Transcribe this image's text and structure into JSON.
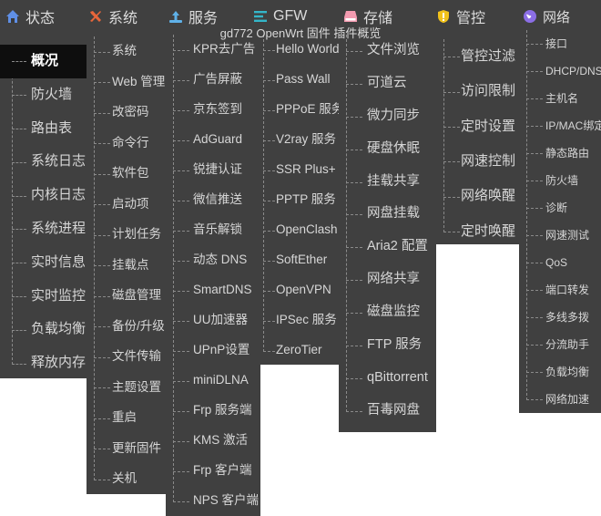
{
  "page_title": "gd772 OpenWrt 固件 插件概览",
  "columns": [
    {
      "key": "status",
      "icon": "home-icon",
      "title": "状态",
      "items": [
        "概况",
        "防火墙",
        "路由表",
        "系统日志",
        "内核日志",
        "系统进程",
        "实时信息",
        "实时监控",
        "负载均衡",
        "释放内存"
      ],
      "active_index": 0
    },
    {
      "key": "system",
      "icon": "tools-icon",
      "title": "系统",
      "items": [
        "系统",
        "Web 管理",
        "改密码",
        "命令行",
        "软件包",
        "启动项",
        "计划任务",
        "挂载点",
        "磁盘管理",
        "备份/升级",
        "文件传输",
        "主题设置",
        "重启",
        "更新固件",
        "关机"
      ]
    },
    {
      "key": "services",
      "icon": "cloud-upload-icon",
      "title": "服务",
      "items": [
        "KPR去广告",
        "广告屏蔽",
        "京东签到",
        "AdGuard",
        "锐捷认证",
        "微信推送",
        "音乐解锁",
        "动态 DNS",
        "SmartDNS",
        "UU加速器",
        "UPnP设置",
        "miniDLNA",
        "Frp 服务端",
        "KMS 激活",
        "Frp 客户端",
        "NPS 客户端"
      ]
    },
    {
      "key": "gfw",
      "icon": "list-icon",
      "title": "GFW",
      "items": [
        "Hello World",
        "Pass Wall",
        "PPPoE 服务",
        "V2ray 服务",
        "SSR Plus+",
        "PPTP 服务",
        "OpenClash",
        "SoftEther",
        "OpenVPN",
        "IPSec 服务",
        "ZeroTier"
      ]
    },
    {
      "key": "storage",
      "icon": "drive-icon",
      "title": "存储",
      "items": [
        "文件浏览",
        "可道云",
        "微力同步",
        "硬盘休眠",
        "挂载共享",
        "网盘挂载",
        "Aria2 配置",
        "网络共享",
        "磁盘监控",
        "FTP 服务",
        "qBittorrent",
        "百毒网盘"
      ]
    },
    {
      "key": "control",
      "icon": "shield-icon",
      "title": "管控",
      "items": [
        "管控过滤",
        "访问限制",
        "定时设置",
        "网速控制",
        "网络唤醒",
        "定时唤醒"
      ]
    },
    {
      "key": "network",
      "icon": "globe-icon",
      "title": "网络",
      "items": [
        "接口",
        "DHCP/DNS",
        "主机名",
        "IP/MAC绑定",
        "静态路由",
        "防火墙",
        "诊断",
        "网速测试",
        "QoS",
        "端口转发",
        "多线多拨",
        "分流助手",
        "负载均衡",
        "网络加速"
      ]
    }
  ],
  "colors": {
    "panel": "#404040",
    "active_bg": "#0e0e0e",
    "tree": "#8a8a8a",
    "page_bg": "#ffffff"
  }
}
